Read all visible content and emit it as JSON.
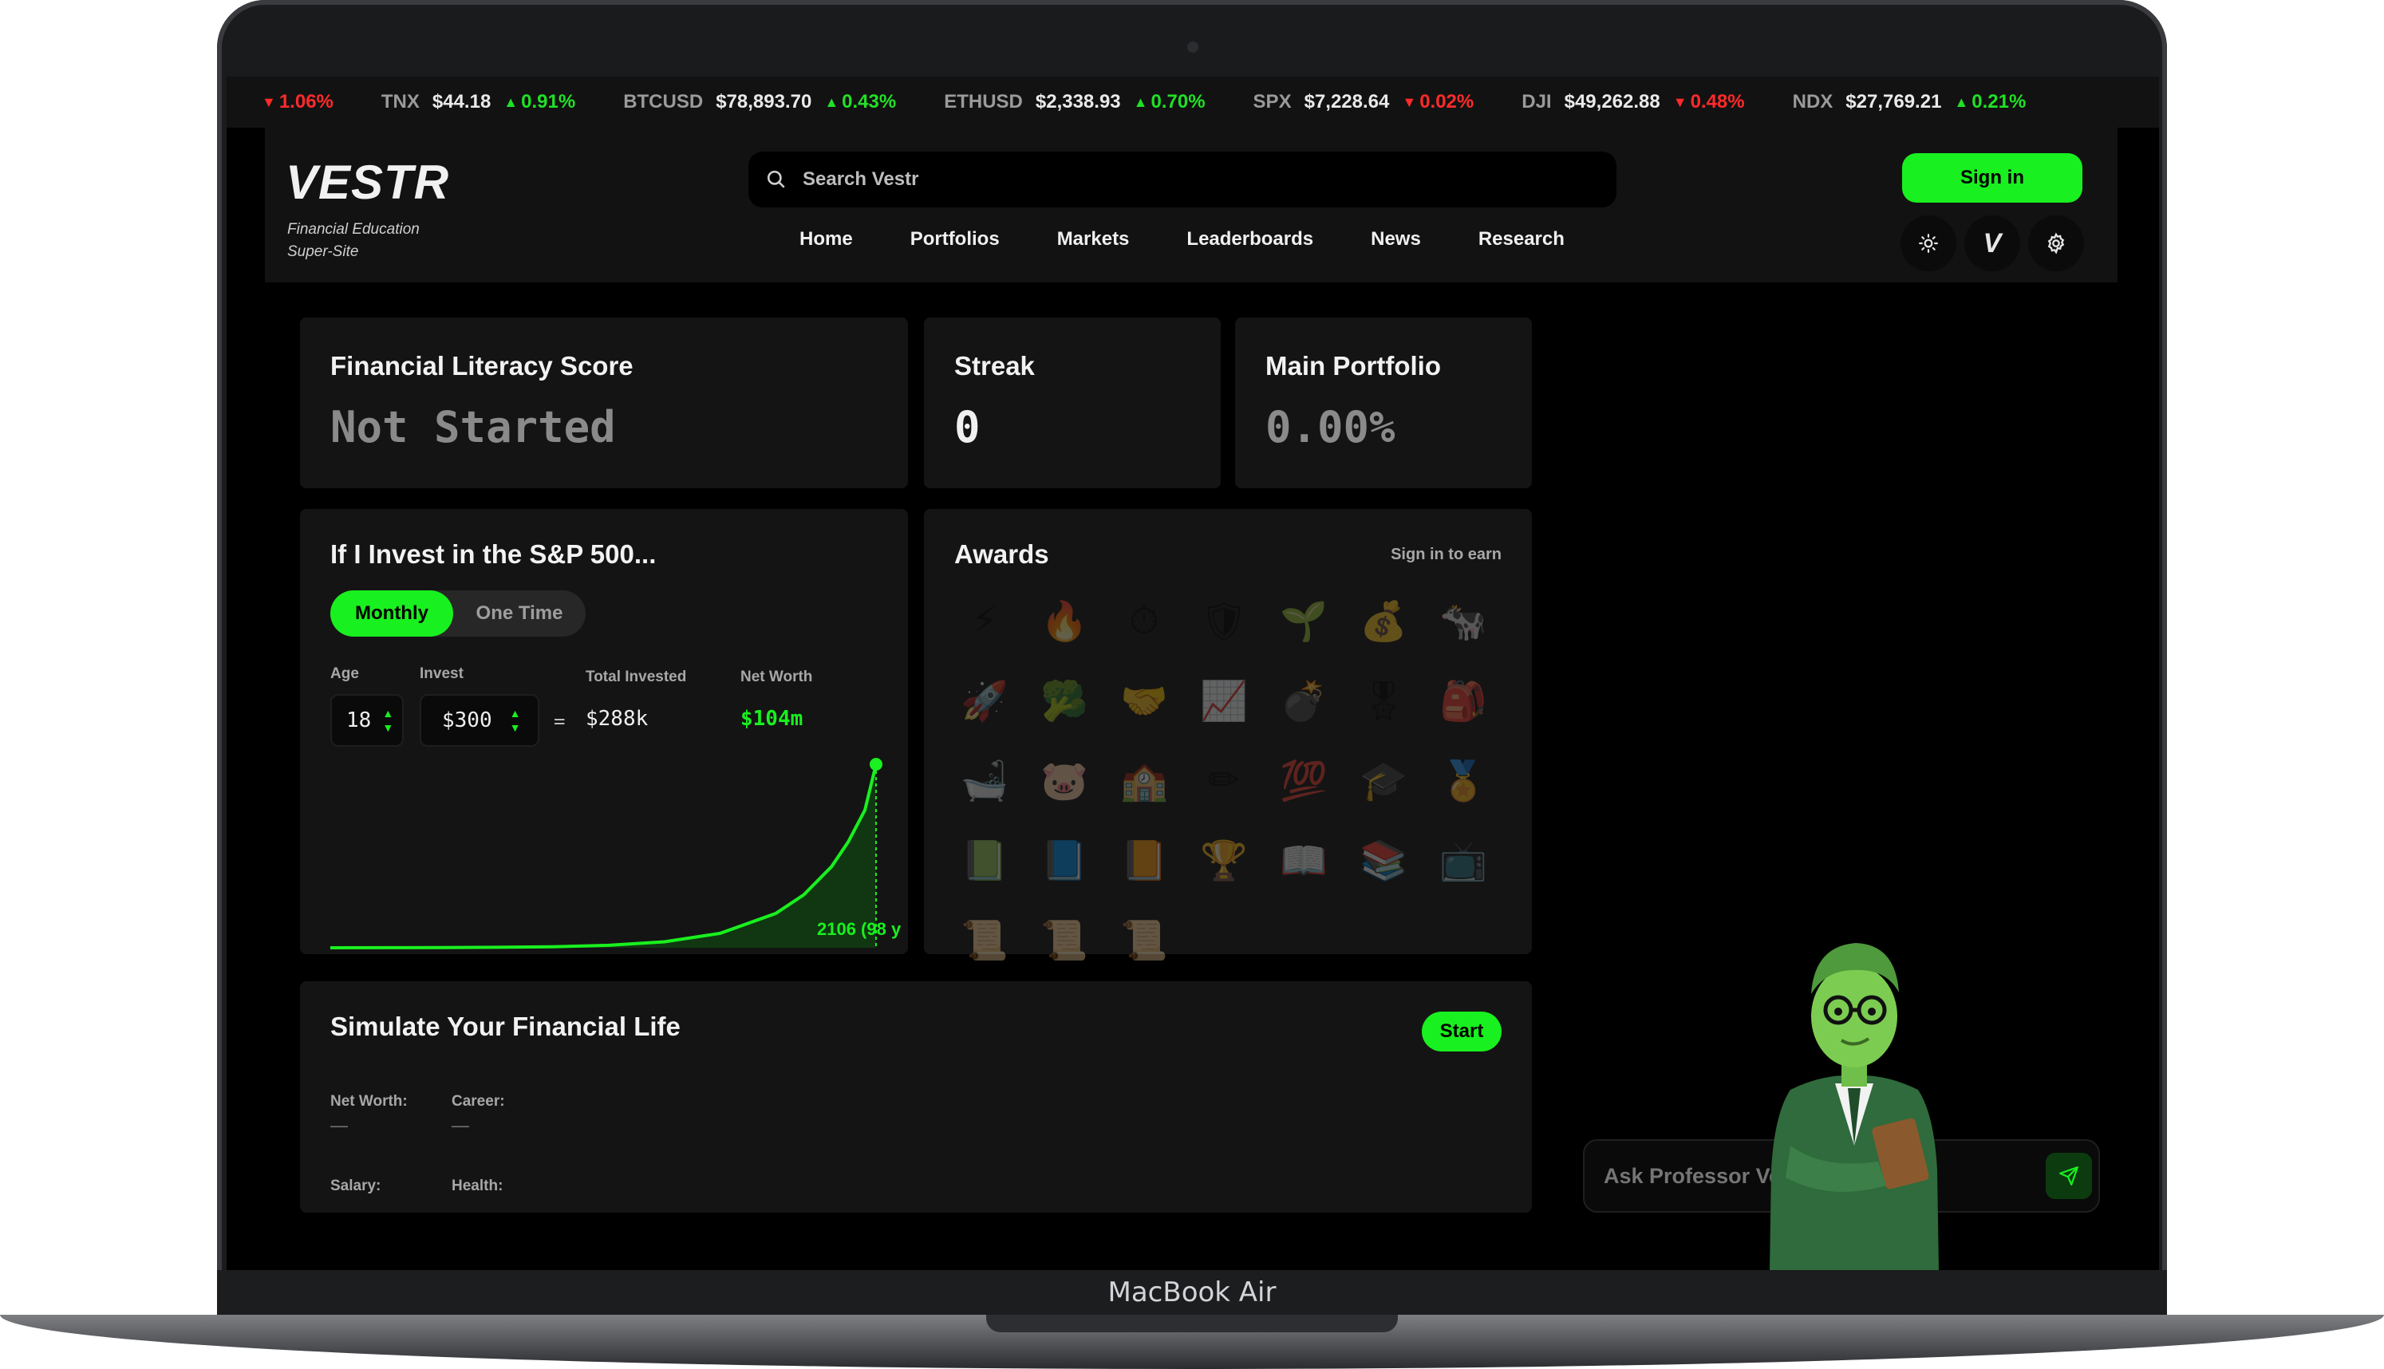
{
  "device": {
    "label": "MacBook Air"
  },
  "ticker": [
    {
      "symbol": "",
      "price": "",
      "change": "1.06%",
      "dir": "down"
    },
    {
      "symbol": "TNX",
      "price": "$44.18",
      "change": "0.91%",
      "dir": "up"
    },
    {
      "symbol": "BTCUSD",
      "price": "$78,893.70",
      "change": "0.43%",
      "dir": "up"
    },
    {
      "symbol": "ETHUSD",
      "price": "$2,338.93",
      "change": "0.70%",
      "dir": "up"
    },
    {
      "symbol": "SPX",
      "price": "$7,228.64",
      "change": "0.02%",
      "dir": "down"
    },
    {
      "symbol": "DJI",
      "price": "$49,262.88",
      "change": "0.48%",
      "dir": "down"
    },
    {
      "symbol": "NDX",
      "price": "$27,769.21",
      "change": "0.21%",
      "dir": "up"
    }
  ],
  "header": {
    "logo": "VESTR",
    "tagline_line1": "Financial Education",
    "tagline_line2": "Super-Site",
    "search_placeholder": "Search Vestr",
    "signin_label": "Sign in",
    "nav": [
      "Home",
      "Portfolios",
      "Markets",
      "Leaderboards",
      "News",
      "Research"
    ],
    "icons": [
      "sun-icon",
      "vestr-v-icon",
      "gear-icon"
    ],
    "v_glyph": "V"
  },
  "literacy": {
    "title": "Financial Literacy Score",
    "value": "Not Started"
  },
  "streak": {
    "title": "Streak",
    "value": "0"
  },
  "portfolio": {
    "title": "Main Portfolio",
    "value": "0.00%"
  },
  "invest": {
    "title": "If I Invest in the S&P 500...",
    "toggle_active": "Monthly",
    "toggle_inactive": "One Time",
    "age_label": "Age",
    "age_value": "18",
    "invest_label": "Invest",
    "invest_value": "$300",
    "equals": "=",
    "total_label": "Total Invested",
    "total_value": "$288k",
    "networth_label": "Net Worth",
    "networth_value": "$104m",
    "end_label": "2106 (98 y"
  },
  "chart_data": {
    "type": "area",
    "x": [
      0,
      10,
      20,
      30,
      40,
      50,
      60,
      70,
      80,
      85,
      90,
      93,
      96,
      98
    ],
    "values": [
      0,
      0.03,
      0.1,
      0.25,
      0.6,
      1.4,
      3.4,
      8.2,
      19.5,
      30,
      46,
      60,
      78,
      104
    ],
    "xlabel": "",
    "ylabel": "",
    "end_label": "2106 (98 y",
    "grid": false,
    "color": "#19f01f"
  },
  "awards": {
    "title": "Awards",
    "action": "Sign in to earn",
    "items": [
      "⚡",
      "🔥",
      "⏱",
      "🛡",
      "🌱",
      "💰",
      "🐄",
      "🚀",
      "🥦",
      "🤝",
      "📈",
      "💣",
      "🎖",
      "🎒",
      "🛁",
      "🐷",
      "🏫",
      "✏",
      "💯",
      "🎓",
      "🏅",
      "📗",
      "📘",
      "📙",
      "🏆",
      "📖",
      "📚",
      "📺",
      "📜",
      "📜",
      "📜"
    ]
  },
  "simulate": {
    "title": "Simulate Your Financial Life",
    "start_label": "Start",
    "fields": [
      {
        "label": "Net Worth:",
        "value": "—"
      },
      {
        "label": "Career:",
        "value": "—"
      },
      {
        "label": "Salary:",
        "value": ""
      },
      {
        "label": "Health:",
        "value": ""
      }
    ]
  },
  "assistant": {
    "placeholder": "Ask Professor Vestr anything...",
    "send_icon": "send-icon"
  },
  "colors": {
    "accent": "#19f01f",
    "down": "#ff2a2a",
    "bg": "#000000",
    "card": "#141414"
  }
}
